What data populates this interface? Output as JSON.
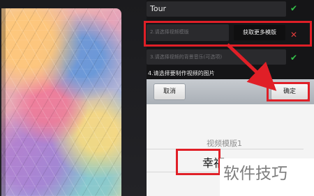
{
  "form": {
    "title_value": "Tour",
    "template_placeholder": "2.请选择视频模版",
    "more_templates_button": "获取更多模版",
    "music_placeholder": "3.请选择视频的背景音乐(可选项)",
    "step4_label": "4.请选择要制作视频的图片"
  },
  "picker": {
    "cancel_label": "取消",
    "confirm_label": "确定",
    "option1": "视频模版1",
    "option2": "幸福"
  },
  "watermark_text": "软件技巧",
  "colors": {
    "accent_red": "#e01f27",
    "check_green": "#34c34a",
    "cross_red": "#e03b3b"
  },
  "icons": {
    "check": "✔",
    "cross": "✕"
  }
}
